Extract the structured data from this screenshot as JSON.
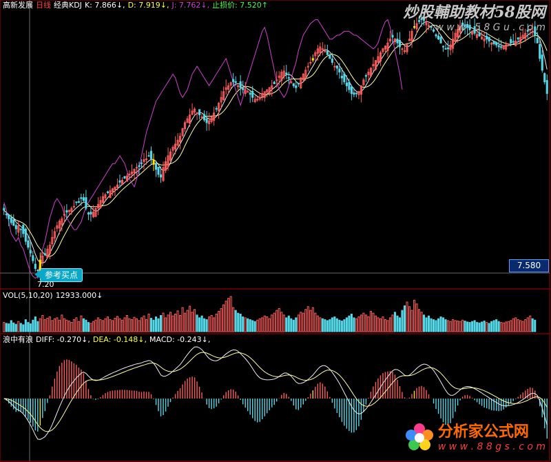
{
  "colors": {
    "bg": "#000000",
    "up": "#ff5c5c",
    "down": "#54d8e8",
    "signal": "#ffe400",
    "line_white": "#f0f0f0",
    "line_yellow": "#ffffa0",
    "line_magenta": "#d040d0",
    "grid": "#b00000"
  },
  "kline_header": {
    "code_name": "高新发展",
    "period": "日线",
    "indicator": "经典KDJ",
    "k": "K: 7.866↓,",
    "d": "D: 7.919↓,",
    "j": "J: 7.762↓,",
    "stop": "止损价: 7.520↑"
  },
  "price_tag": "7.580",
  "buy_label": "参考买点",
  "low_price": "7.20",
  "vol_header": {
    "name": "VOL(5,10,20)",
    "value": "12933.000↓"
  },
  "macd_header": {
    "name": "浪中有浪",
    "diff": "DIFF: -0.270↓,",
    "dea": "DEA: -0.148↓,",
    "macd": "MACD: -0.243↓,"
  },
  "watermark_top": {
    "line1": "炒股輔助教材58股网",
    "line2": "w w w . 5 8 G u . c o m"
  },
  "watermark_bottom": {
    "line1": "分析家公式网",
    "line2": "w w w . 8 8 g s . c o m"
  },
  "chart_data": {
    "type": "candlestick",
    "price_anchor": 7.58,
    "close": [
      8.9,
      8.78,
      8.68,
      8.58,
      8.51,
      8.42,
      8.5,
      8.4,
      8.3,
      8.1,
      7.95,
      7.8,
      7.6,
      7.4,
      7.35,
      7.62,
      7.72,
      7.75,
      7.9,
      8.0,
      8.2,
      8.35,
      8.5,
      8.62,
      8.68,
      8.8,
      8.85,
      8.9,
      8.95,
      9.0,
      9.1,
      9.1,
      9.2,
      9.15,
      8.95,
      8.8,
      8.8,
      8.85,
      8.95,
      9.05,
      9.15,
      9.25,
      9.3,
      9.35,
      9.4,
      9.45,
      9.5,
      9.55,
      9.62,
      9.67,
      9.72,
      9.78,
      9.83,
      9.88,
      9.95,
      10.0,
      10.02,
      10.1,
      10.2,
      10.22,
      10.3,
      10.22,
      10.08,
      9.95,
      9.82,
      9.75,
      10.0,
      10.15,
      10.3,
      10.4,
      10.52,
      10.6,
      10.7,
      10.8,
      11.0,
      11.15,
      11.25,
      11.35,
      11.45,
      11.5,
      11.4,
      11.35,
      11.3,
      11.22,
      11.15,
      11.2,
      11.3,
      11.4,
      11.5,
      11.65,
      11.8,
      11.95,
      12.05,
      12.1,
      12.18,
      12.2,
      12.18,
      12.1,
      12.05,
      12.0,
      12.0,
      11.95,
      11.88,
      11.8,
      11.75,
      11.75,
      11.8,
      11.9,
      11.95,
      12.0,
      12.05,
      12.1,
      12.15,
      12.25,
      12.35,
      12.45,
      12.48,
      12.4,
      12.3,
      12.2,
      12.1,
      12.05,
      12.15,
      12.3,
      12.4,
      12.5,
      12.6,
      12.7,
      12.8,
      12.95,
      13.05,
      13.1,
      13.05,
      13.0,
      12.9,
      12.8,
      12.7,
      12.6,
      12.55,
      12.45,
      12.3,
      12.2,
      12.1,
      12.0,
      11.9,
      11.88,
      11.9,
      11.95,
      12.1,
      12.25,
      12.35,
      12.45,
      12.55,
      12.65,
      12.75,
      12.85,
      12.95,
      13.05,
      13.12,
      13.2,
      13.3,
      13.35,
      13.3,
      13.2,
      13.1,
      13.05,
      13.0,
      13.15,
      13.3,
      13.5,
      13.6,
      13.7,
      13.75,
      13.8,
      13.78,
      13.72,
      13.65,
      13.6,
      13.5,
      13.38,
      13.3,
      13.2,
      13.1,
      13.05,
      13.05,
      13.15,
      13.3,
      13.45,
      13.55,
      13.62,
      13.65,
      13.62,
      13.6,
      13.55,
      13.5,
      13.45,
      13.42,
      13.38,
      13.35,
      13.3,
      13.3,
      13.25,
      13.2,
      13.18,
      13.15,
      13.1,
      13.1,
      13.12,
      13.15,
      13.18,
      13.2,
      13.22,
      13.25,
      13.3,
      13.35,
      13.4,
      13.45,
      13.5,
      13.55,
      13.5,
      13.4,
      13.2,
      12.8,
      12.5,
      12.2,
      11.9
    ],
    "volume": [
      2,
      1.8,
      1.7,
      2.4,
      1.9,
      1.6,
      2.2,
      1.8,
      1.5,
      2.6,
      2,
      1.7,
      2.5,
      3.2,
      2.2,
      2.8,
      3.5,
      2.6,
      2.9,
      3.2,
      2.4,
      2.8,
      3.0,
      2.5,
      3.6,
      2.8,
      2.5,
      2.3,
      2.0,
      2.6,
      3.0,
      2.2,
      3.4,
      2.8,
      2.5,
      2.0,
      1.8,
      2.2,
      2.5,
      3.0,
      2.6,
      2.4,
      2.8,
      3.2,
      2.6,
      2.4,
      2.9,
      3.3,
      2.8,
      2.5,
      3.0,
      3.5,
      2.8,
      2.6,
      3.1,
      2.8,
      2.4,
      3.0,
      3.4,
      2.6,
      3.8,
      2.9,
      2.5,
      3.2,
      2.8,
      3.5,
      4.0,
      3.0,
      3.6,
      4.2,
      3.4,
      3.8,
      4.5,
      3.5,
      5.2,
      4.0,
      4.6,
      5.5,
      4.2,
      4.8,
      3.6,
      3.0,
      3.4,
      2.8,
      2.6,
      3.2,
      3.5,
      3.0,
      3.8,
      4.4,
      5.0,
      5.8,
      6.6,
      7.2,
      7.6,
      5.2,
      4.6,
      4.0,
      3.8,
      3.2,
      3.0,
      2.8,
      2.6,
      2.4,
      2.2,
      2.5,
      2.8,
      3.0,
      3.4,
      3.2,
      2.8,
      3.6,
      4.0,
      4.6,
      5.0,
      4.2,
      3.6,
      3.0,
      3.4,
      2.8,
      2.5,
      3.0,
      3.6,
      4.2,
      4.0,
      4.8,
      5.4,
      4.6,
      5.2,
      4.0,
      3.4,
      3.0,
      2.8,
      2.6,
      2.4,
      2.6,
      3.0,
      3.2,
      2.8,
      2.5,
      2.3,
      2.6,
      3.0,
      3.4,
      3.8,
      3.0,
      2.8,
      3.2,
      3.6,
      4.0,
      3.6,
      3.2,
      4.4,
      4.0,
      3.4,
      3.0,
      2.8,
      3.2,
      2.6,
      2.4,
      3.0,
      3.6,
      4.2,
      3.4,
      3.0,
      4.6,
      5.6,
      6.4,
      5.4,
      4.6,
      6.8,
      6.0,
      4.8,
      4.2,
      3.6,
      3.0,
      3.4,
      2.8,
      2.6,
      2.4,
      2.8,
      3.2,
      3.0,
      2.6,
      2.4,
      2.2,
      2.6,
      2.4,
      2.3,
      2.2,
      2.5,
      2.3,
      2.1,
      2.0,
      2.2,
      2.4,
      2.0,
      1.9,
      2.1,
      2.3,
      2.0,
      1.8,
      2.2,
      2.4,
      2.6,
      2.2,
      2.0,
      1.9,
      2.1,
      2.2,
      2.4,
      2.8,
      3.0,
      2.6,
      2.4,
      2.2,
      2.6,
      3.0,
      3.4,
      2.8,
      2.5
    ],
    "kdj_j": [
      9.1,
      8.9,
      8.6,
      8.3,
      8.2,
      8.1,
      8.2,
      8.0,
      7.9,
      7.7,
      7.5,
      7.3,
      7.2,
      7.15,
      7.2,
      7.6,
      7.9,
      8.1,
      8.4,
      8.7,
      8.9,
      9.1,
      9.2,
      9.1,
      9.0,
      8.8,
      8.7,
      8.6,
      8.5,
      8.4,
      8.4,
      8.5,
      8.6,
      8.8,
      9.0,
      9.1,
      9.2,
      9.3,
      9.4,
      9.5,
      9.6,
      9.7,
      9.8,
      9.9,
      10.0,
      10.1,
      10.1,
      10.2,
      10.3,
      10.2,
      10.1,
      9.9,
      9.7,
      9.6,
      9.5,
      9.7,
      10.0,
      10.3,
      10.6,
      10.9,
      11.1,
      11.3,
      11.5,
      11.7,
      11.8,
      11.9,
      12.0,
      12.1,
      12.2,
      12.3,
      12.4,
      12.3,
      12.1,
      11.9,
      11.8,
      11.9,
      12.0,
      12.2,
      12.4,
      12.5,
      12.6,
      12.5,
      12.4,
      12.3,
      12.2,
      12.1,
      12.2,
      12.3,
      12.4,
      12.5,
      12.6,
      12.7,
      12.8,
      12.6,
      12.4,
      12.2,
      12.0,
      11.8,
      11.6,
      11.8,
      12.1,
      12.3,
      12.5,
      12.7,
      12.9,
      13.1,
      13.3,
      13.5,
      13.6,
      13.4,
      13.1,
      12.8,
      12.5,
      12.2,
      12.0,
      11.9,
      11.8,
      11.9,
      12.1,
      12.3,
      12.5,
      12.7,
      13.0,
      13.2,
      13.4,
      13.5,
      13.6,
      13.7,
      13.75,
      13.8,
      13.8,
      13.7,
      13.6,
      13.5,
      13.4,
      13.3,
      13.3,
      13.35,
      13.4,
      13.4,
      13.45,
      13.5,
      13.5,
      13.5,
      13.45,
      13.4,
      13.4,
      13.35,
      13.3,
      13.25,
      13.2,
      13.15,
      13.1,
      13.05,
      13.1,
      13.2,
      13.4,
      13.6,
      13.75,
      13.8,
      13.6,
      13.3,
      13.0,
      12.7,
      12.4,
      12.0
    ]
  }
}
